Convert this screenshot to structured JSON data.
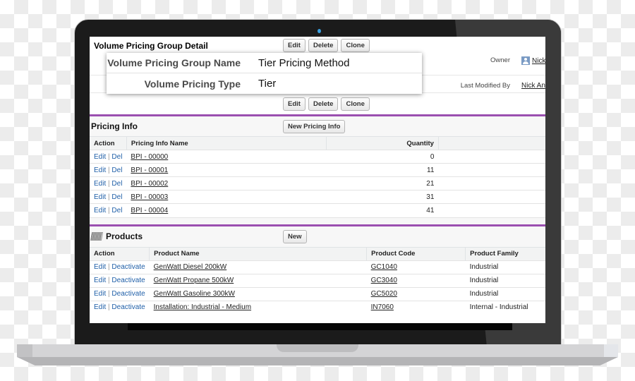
{
  "detail": {
    "title": "Volume Pricing Group Detail",
    "buttons": {
      "edit": "Edit",
      "delete": "Delete",
      "clone": "Clone"
    },
    "owner_label": "Owner",
    "owner_value": "Nick",
    "last_modified_label": "Last Modified By",
    "last_modified_value": "Nick An"
  },
  "popup": {
    "fields": [
      {
        "label": "Volume Pricing Group Name",
        "value": "Tier Pricing Method"
      },
      {
        "label": "Volume Pricing Type",
        "value": "Tier"
      }
    ]
  },
  "pricing_info": {
    "title": "Pricing Info",
    "new_button": "New Pricing Info",
    "columns": [
      "Action",
      "Pricing Info Name",
      "Quantity"
    ],
    "action_edit": "Edit",
    "action_sep": "|",
    "action_del": "Del",
    "rows": [
      {
        "name": "BPI - 00000",
        "quantity": "0"
      },
      {
        "name": "BPI - 00001",
        "quantity": "11"
      },
      {
        "name": "BPI - 00002",
        "quantity": "21"
      },
      {
        "name": "BPI - 00003",
        "quantity": "31"
      },
      {
        "name": "BPI - 00004",
        "quantity": "41"
      }
    ]
  },
  "products": {
    "title": "Products",
    "new_button": "New",
    "columns": [
      "Action",
      "Product Name",
      "Product Code",
      "Product Family"
    ],
    "action_edit": "Edit",
    "action_sep": "|",
    "action_deactivate": "Deactivate",
    "rows": [
      {
        "name": "GenWatt Diesel 200kW",
        "code": "GC1040",
        "family": "Industrial"
      },
      {
        "name": "GenWatt Propane 500kW",
        "code": "GC3040",
        "family": "Industrial"
      },
      {
        "name": "GenWatt Gasoline 300kW",
        "code": "GC5020",
        "family": "Industrial"
      },
      {
        "name": "Installation: Industrial - Medium",
        "code": "IN7060",
        "family": "Internal - Industrial"
      }
    ]
  },
  "colors": {
    "section_accent": "#9b4fb0",
    "action_link": "#1f5fa8",
    "camera_led": "#3aa0e0"
  }
}
